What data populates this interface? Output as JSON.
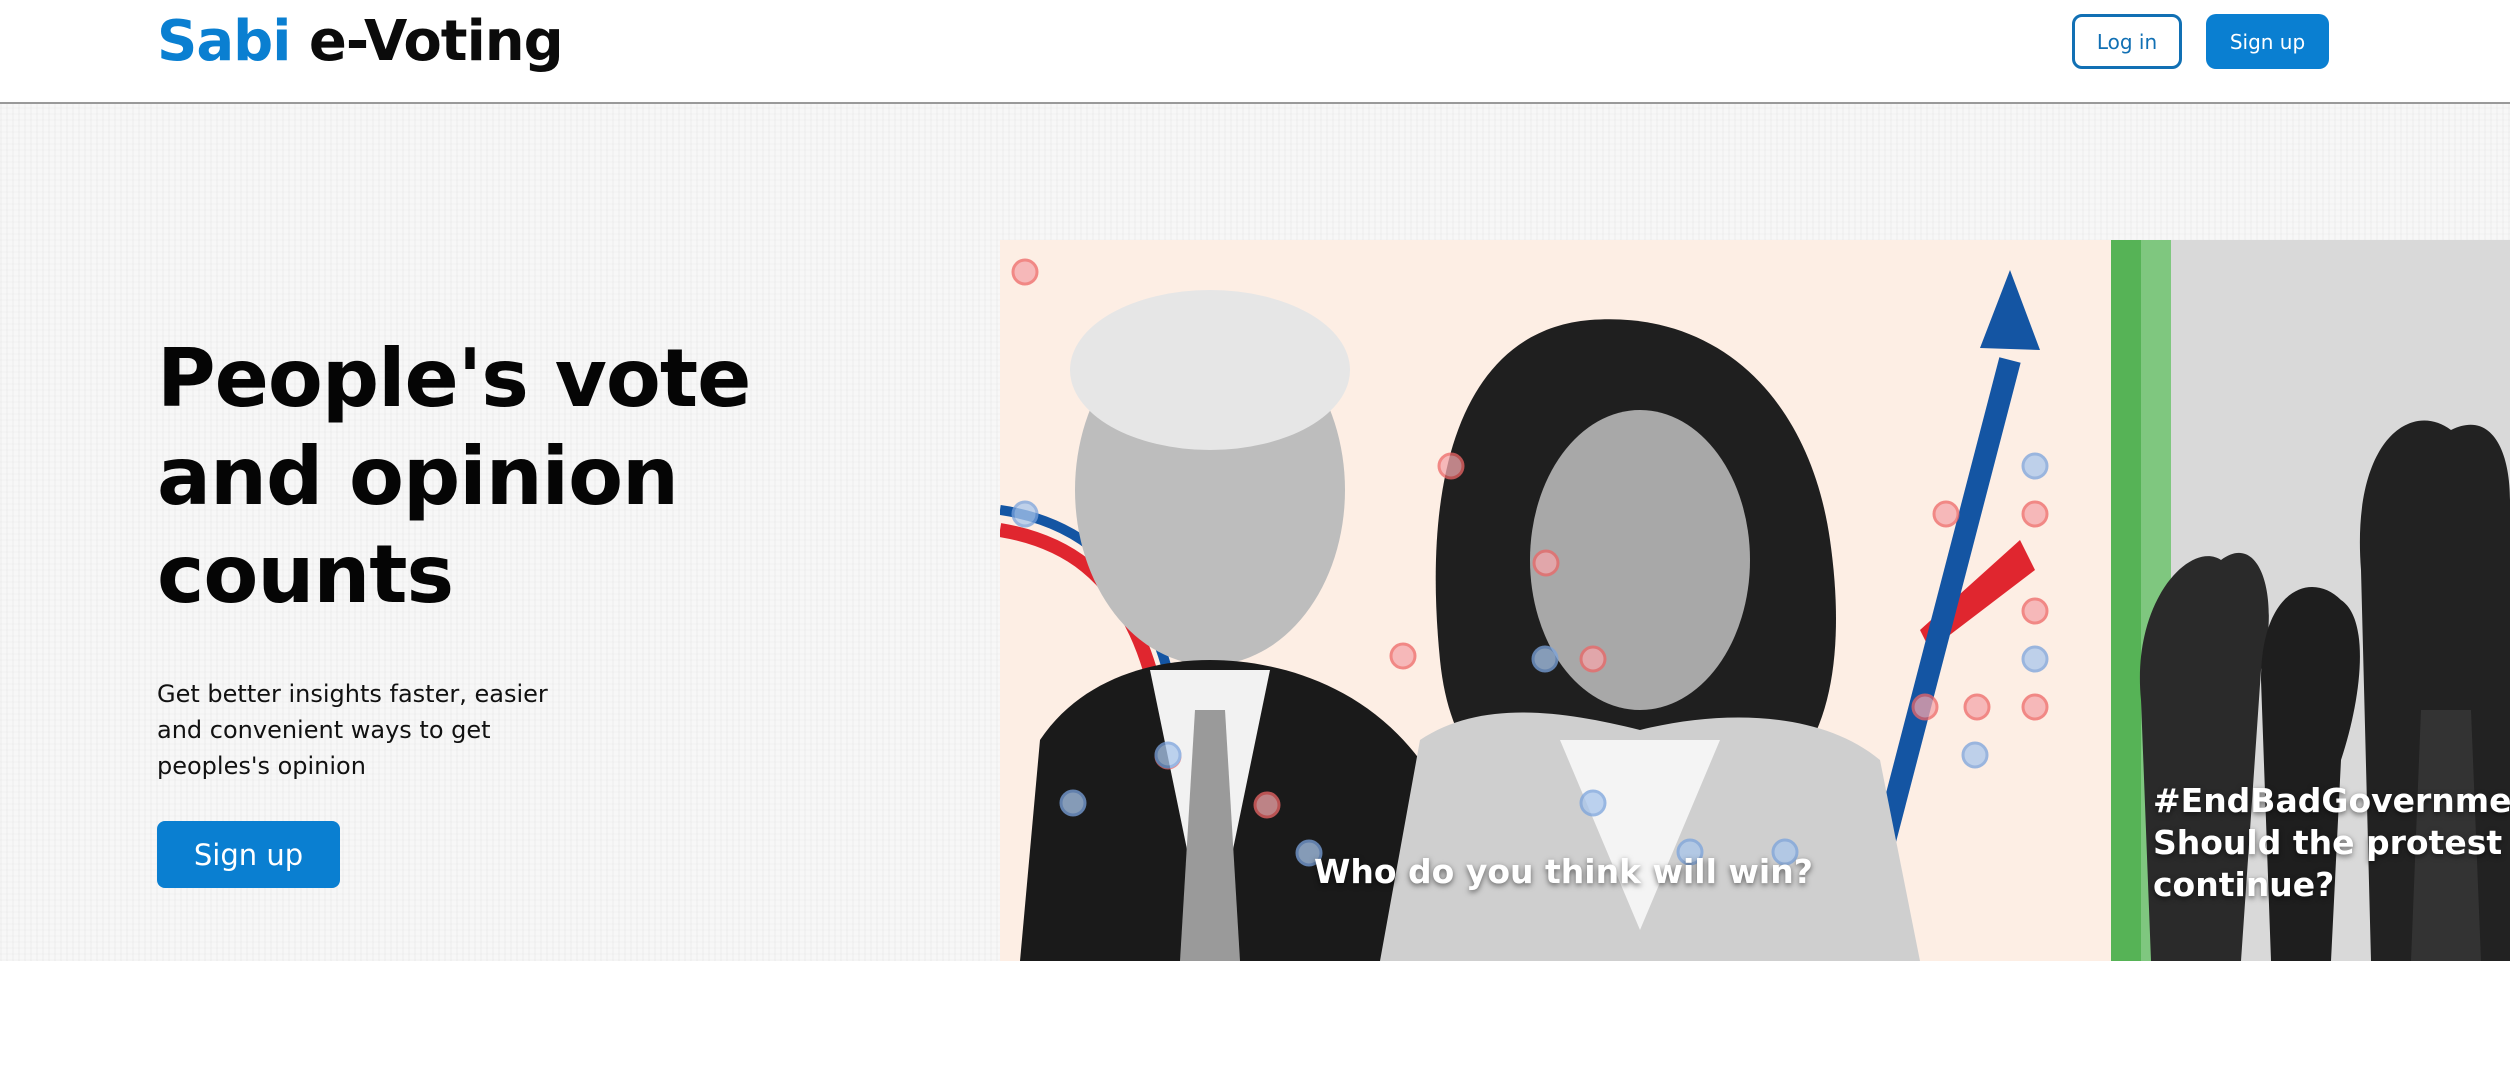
{
  "header": {
    "logo_brand": "Sabi",
    "logo_rest": " e-Voting",
    "login_label": "Log in",
    "signup_label": "Sign up"
  },
  "hero": {
    "title": "People's vote and opinion counts",
    "subtitle": "Get better insights faster, easier and convenient ways to get peoples's opinion",
    "signup_label": "Sign up"
  },
  "carousel": {
    "slides": [
      {
        "caption": "Who do you think will win?",
        "image": "election-candidates-photo"
      },
      {
        "caption_line1": "#EndBadGovernme",
        "caption_line2": "Should the protest",
        "caption_line3": "continue?",
        "image": "raised-fists-protest-photo"
      }
    ]
  },
  "colors": {
    "brand_blue": "#0a7fd1",
    "outline_blue": "#1170b4",
    "slide1_bg": "#fdeee4",
    "accent_red": "#e0262f"
  }
}
